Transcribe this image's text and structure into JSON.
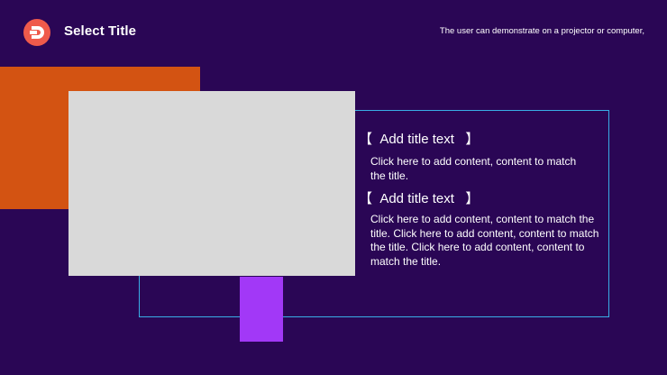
{
  "header": {
    "logo_icon": "brand-logo-d-icon",
    "title": "Select Title",
    "caption": "The user can demonstrate on a projector or computer,"
  },
  "colors": {
    "background": "#2a0655",
    "logo": "#ef5a4b",
    "orange_block": "#d35312",
    "frame_outline": "#39aee6",
    "purple_block": "#a238f7",
    "image_placeholder": "#d9d9d9"
  },
  "content": {
    "items": [
      {
        "title": "【  Add title text   】",
        "body": "Click here to add content, content to match the title."
      },
      {
        "title": "【  Add title text   】",
        "body": "Click here to add content, content to match the title. Click here to add content, content to match the title. Click here to add content, content to match the title."
      }
    ]
  }
}
